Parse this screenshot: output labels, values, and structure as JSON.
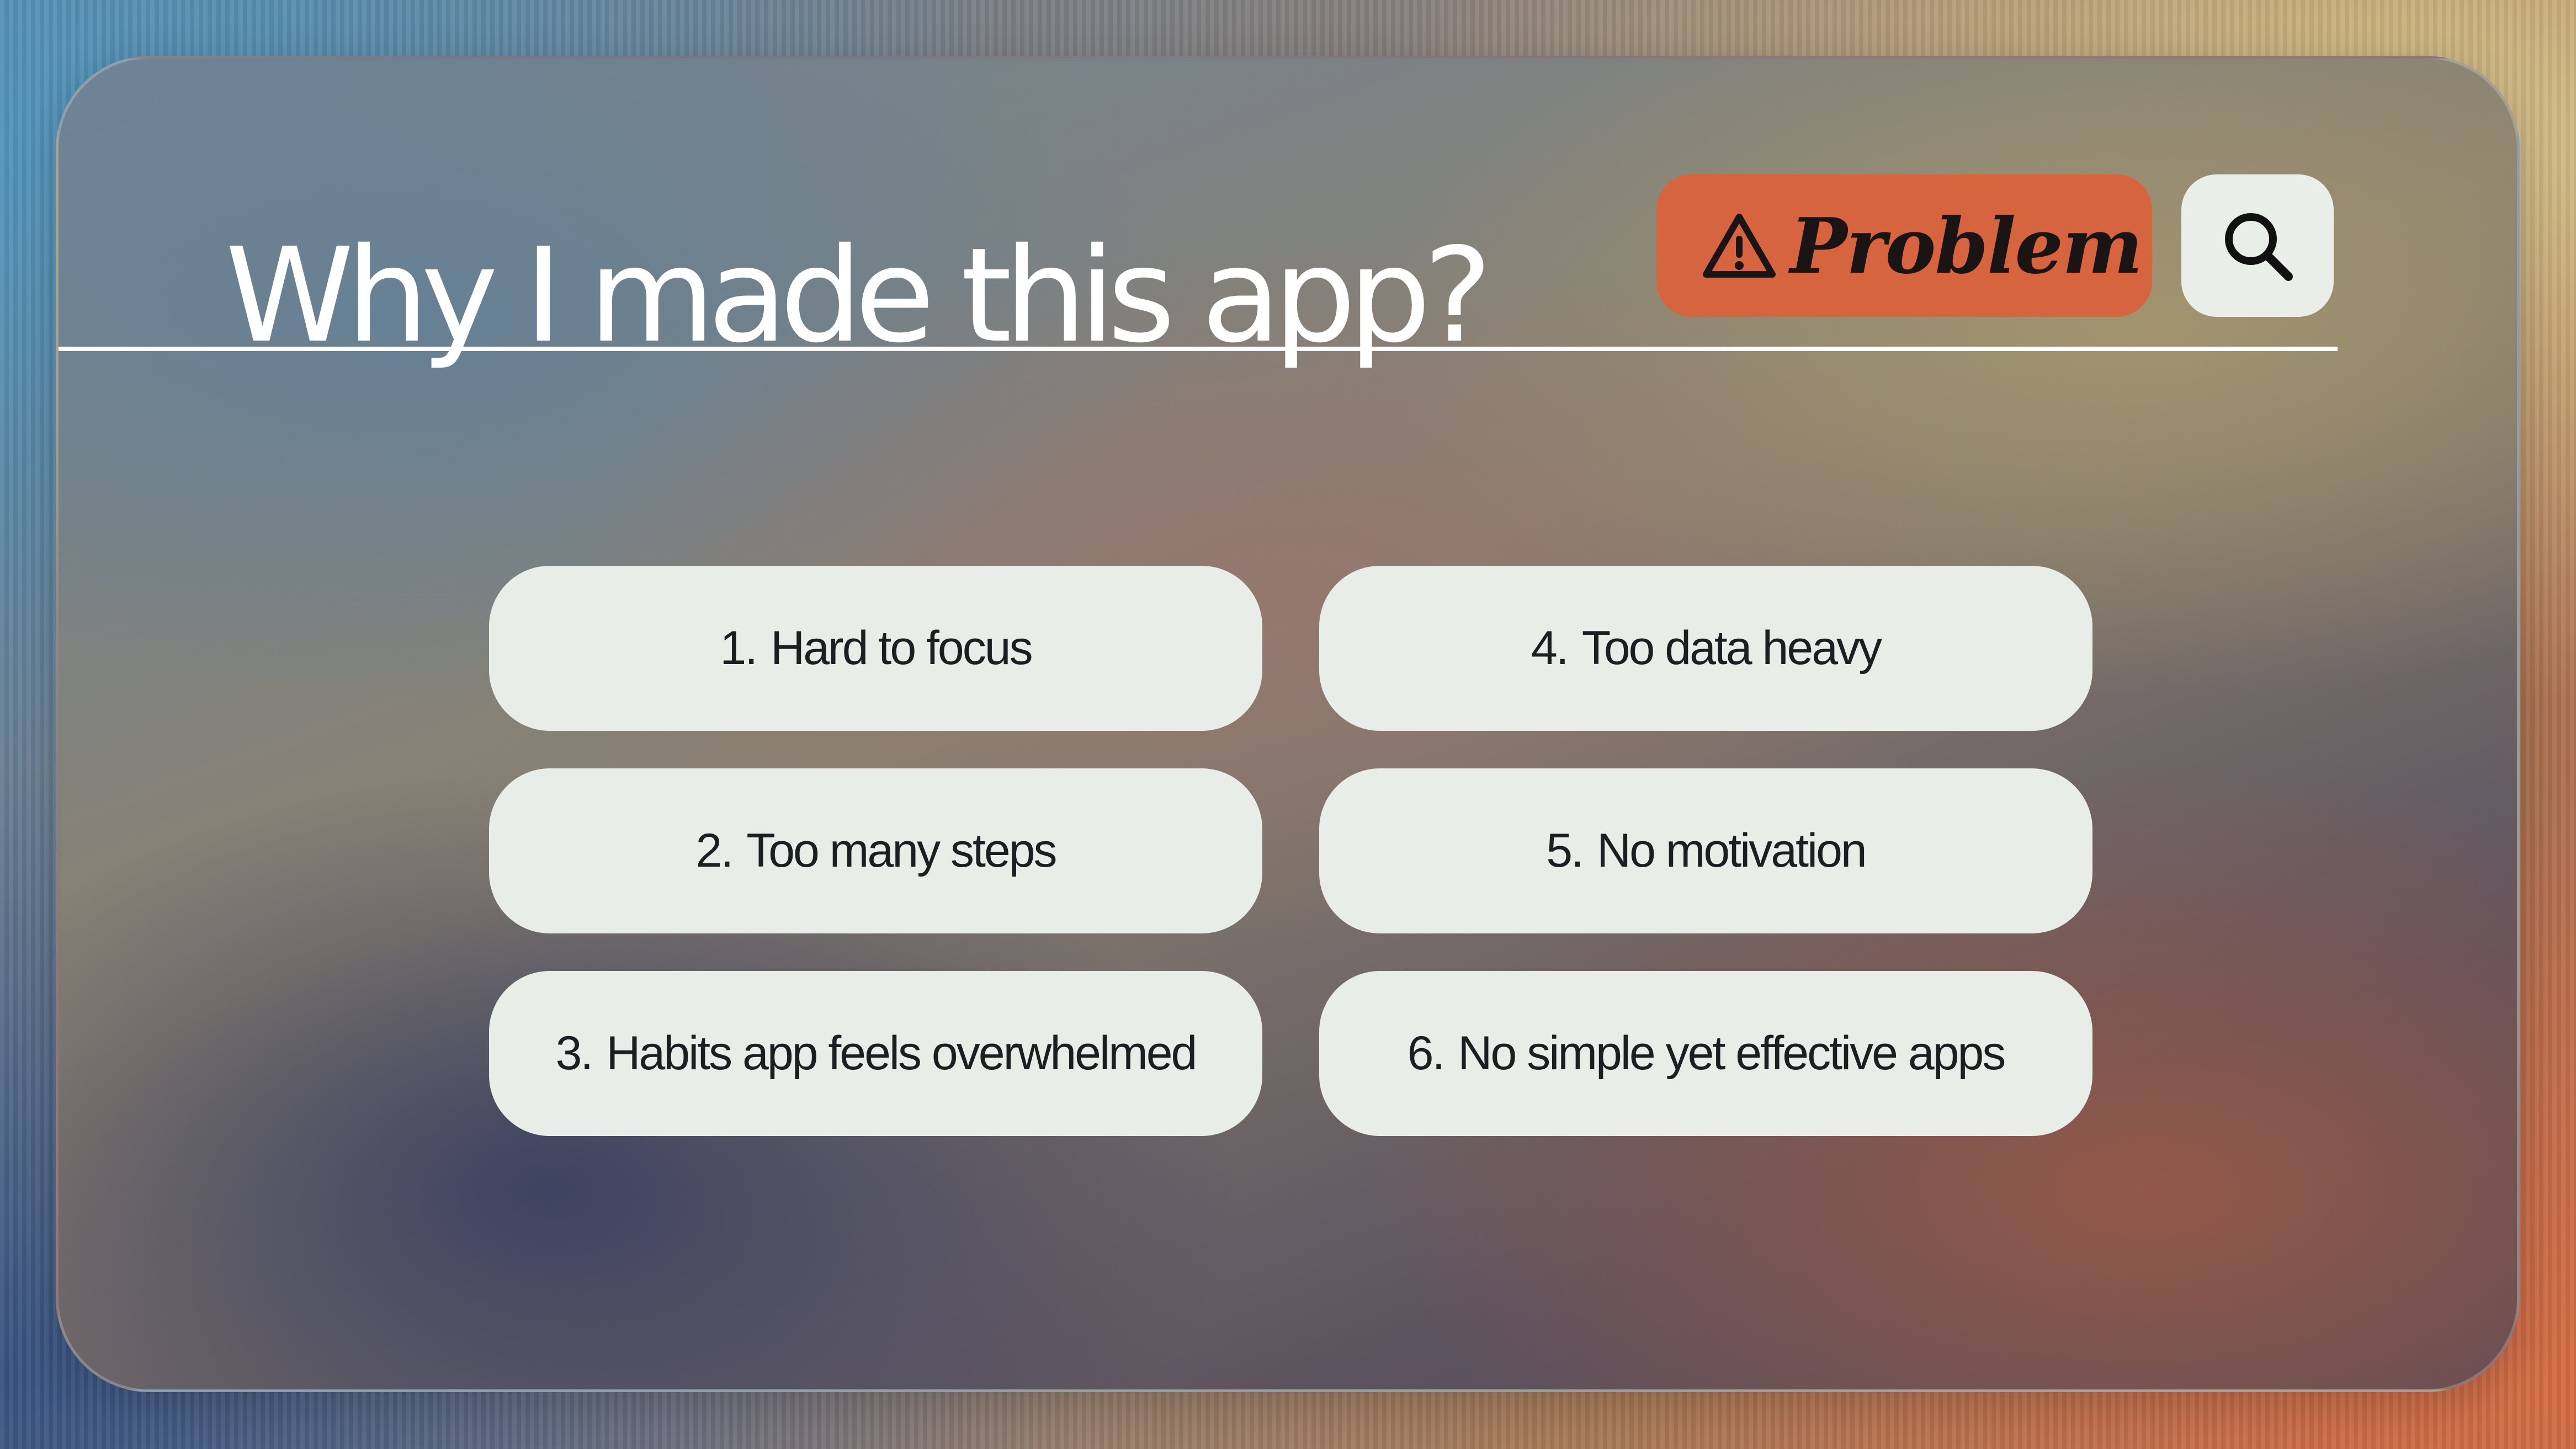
{
  "slide": {
    "title": "Why I made this app?",
    "badge": {
      "icon": "warning-triangle-icon",
      "label": "Problem",
      "color": "#d6643f"
    },
    "search_button": {
      "icon": "search-icon"
    },
    "items": [
      {
        "number": "1.",
        "text": "Hard to focus"
      },
      {
        "number": "2.",
        "text": "Too many steps"
      },
      {
        "number": "3.",
        "text": "Habits app feels overwhelmed"
      },
      {
        "number": "4.",
        "text": "Too data heavy"
      },
      {
        "number": "5.",
        "text": "No motivation"
      },
      {
        "number": "6.",
        "text": "No simple yet effective apps"
      }
    ]
  }
}
